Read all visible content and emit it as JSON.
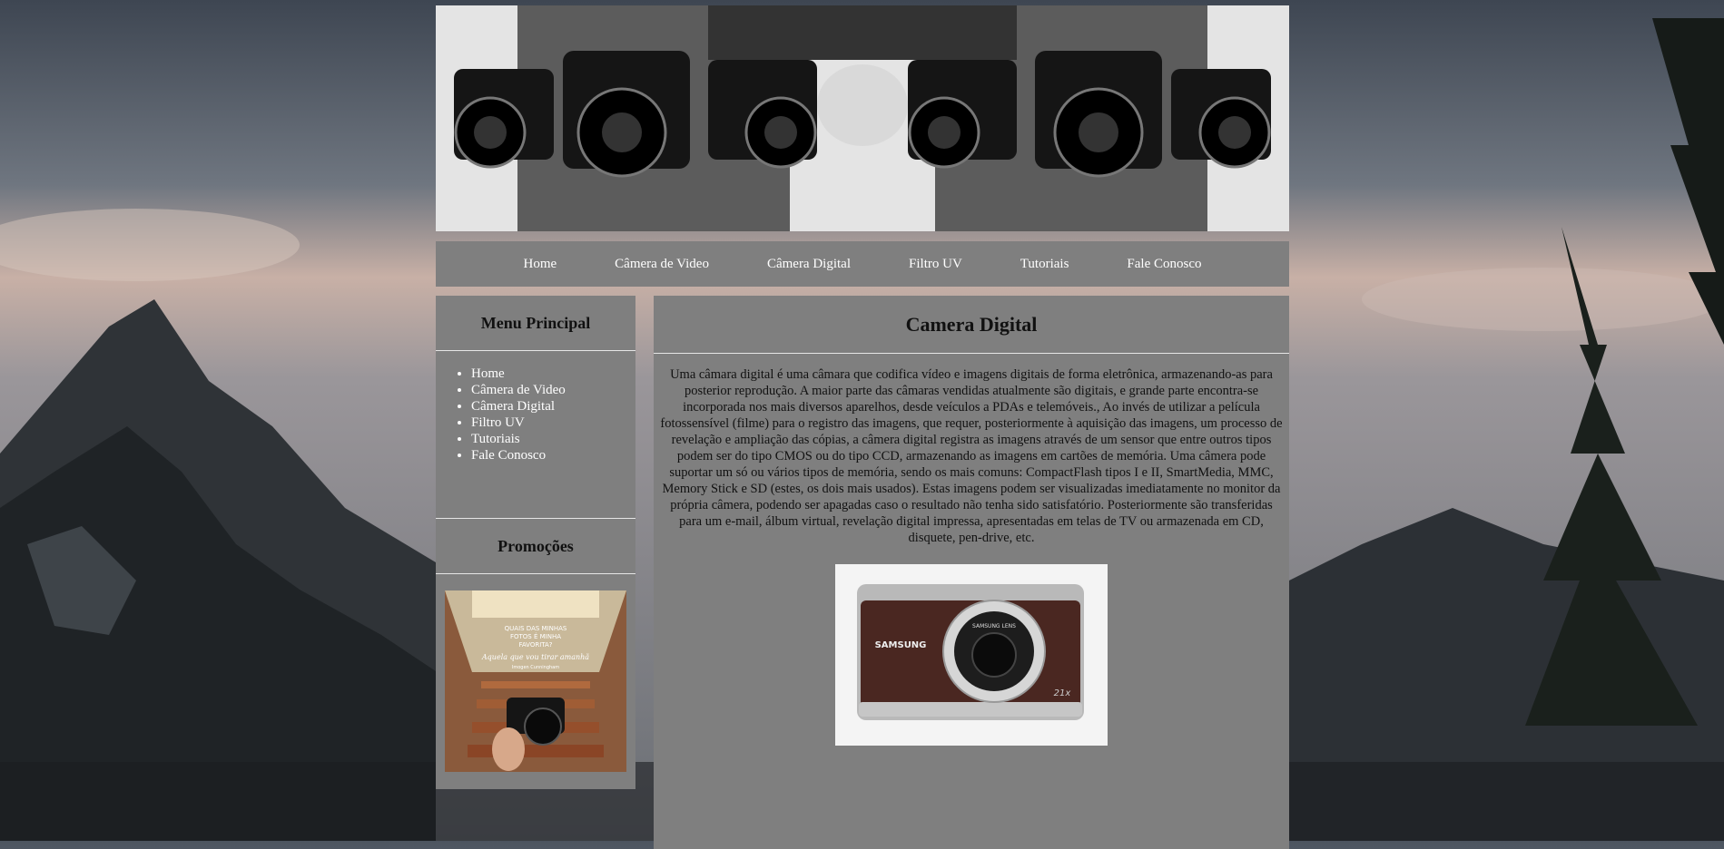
{
  "nav": {
    "items": [
      "Home",
      "Câmera de Video",
      "Câmera Digital",
      "Filtro UV",
      "Tutoriais",
      "Fale Conosco"
    ]
  },
  "sidebar": {
    "menu_title": "Menu Principal",
    "items": [
      "Home",
      "Câmera de Video",
      "Câmera Digital",
      "Filtro UV",
      "Tutoriais",
      "Fale Conosco"
    ],
    "promo_title": "Promoções",
    "promo_image": {
      "text": [
        "QUAIS DAS MINHAS",
        "FOTOS É MINHA",
        "FAVORITA?",
        "Aquela que vou tirar amanhã",
        "Imogen Cunningham"
      ]
    }
  },
  "main": {
    "title": "Camera Digital",
    "body": "Uma câmara digital é uma câmara que codifica vídeo e imagens digitais de forma eletrônica, armazenando-as para posterior reprodução. A maior parte das câmaras vendidas atualmente são digitais, e grande parte encontra-se incorporada nos mais diversos aparelhos, desde veículos a PDAs e telemóveis., Ao invés de utilizar a película fotossensível (filme) para o registro das imagens, que requer, posteriormente à aquisição das imagens, um processo de revelação e ampliação das cópias, a câmera digital registra as imagens através de um sensor que entre outros tipos podem ser do tipo CMOS ou do tipo CCD, armazenando as imagens em cartões de memória. Uma câmera pode suportar um só ou vários tipos de memória, sendo os mais comuns: CompactFlash tipos I e II, SmartMedia, MMC, Memory Stick e SD (estes, os dois mais usados). Estas imagens podem ser visualizadas imediatamente no monitor da própria câmera, podendo ser apagadas caso o resultado não tenha sido satisfatório. Posteriormente são transferidas para um e-mail, álbum virtual, revelação digital impressa, apresentadas em telas de TV ou armazenada em CD, disquete, pen-drive, etc.",
    "camera_image": {
      "brand": "SAMSUNG",
      "lens_text": "SAMSUNG LENS",
      "zoom": "21x"
    }
  },
  "colors": {
    "panel": "#7f7f7f",
    "divider": "#e6e6e6",
    "link": "#ffffff"
  }
}
